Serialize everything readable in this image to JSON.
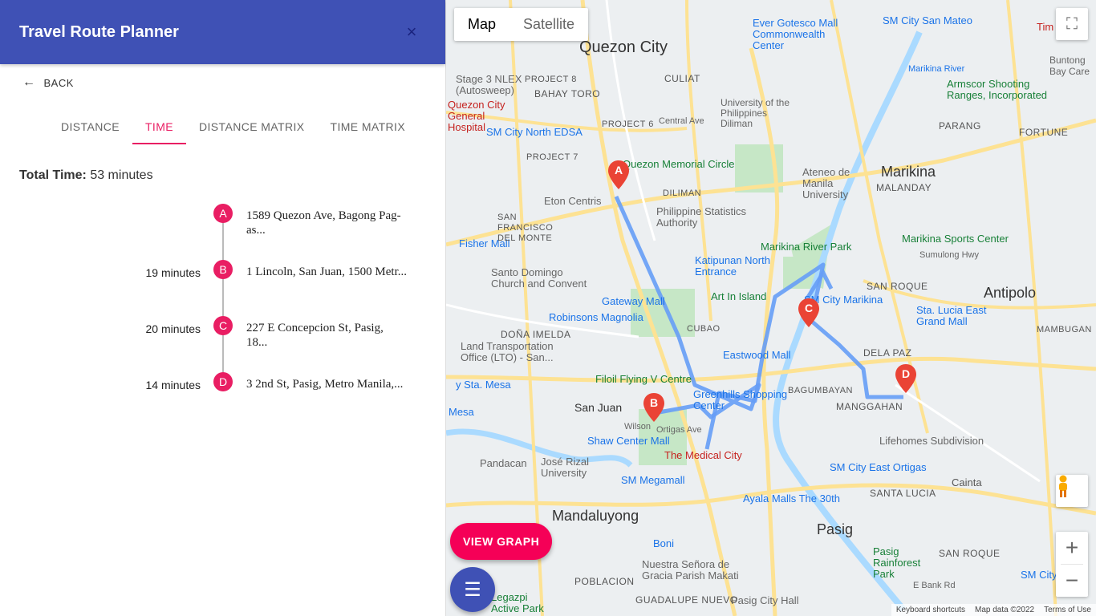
{
  "app": {
    "title": "Travel Route Planner",
    "close_icon": "×"
  },
  "back": {
    "label": "BACK"
  },
  "tabs": [
    {
      "label": "DISTANCE",
      "active": false
    },
    {
      "label": "TIME",
      "active": true
    },
    {
      "label": "DISTANCE MATRIX",
      "active": false
    },
    {
      "label": "TIME MATRIX",
      "active": false
    }
  ],
  "summary": {
    "label": "Total Time:",
    "value": "53 minutes"
  },
  "stops": [
    {
      "letter": "A",
      "duration": "",
      "address": "1589 Quezon Ave, Bagong Pag-as..."
    },
    {
      "letter": "B",
      "duration": "19 minutes",
      "address": "1 Lincoln, San Juan, 1500 Metr..."
    },
    {
      "letter": "C",
      "duration": "20 minutes",
      "address": "227 E Concepcion St, Pasig, 18..."
    },
    {
      "letter": "D",
      "duration": "14 minutes",
      "address": "3 2nd St, Pasig, Metro Manila,..."
    }
  ],
  "map": {
    "type_controls": {
      "map": "Map",
      "satellite": "Satellite"
    },
    "labels": {
      "quezon_city": "Quezon City",
      "marikina": "Marikina",
      "antipolo": "Antipolo",
      "mandaluyong": "Mandaluyong",
      "pasig": "Pasig",
      "san_juan": "San Juan",
      "cainta": "Cainta",
      "ever_gotesco": "Ever Gotesco Mall",
      "commonwealth": "Commonwealth Center",
      "sm_san_mateo": "SM City San Mateo",
      "quezon_memorial": "Quezon Memorial Circle",
      "eton": "Eton Centris",
      "psa": "Philippine Statistics Authority",
      "fisher": "Fisher Mall",
      "santo_domingo": "Santo Domingo Church and Convent",
      "gateway": "Gateway Mall",
      "art_in_island": "Art In Island",
      "robinsons_magnolia": "Robinsons Magnolia",
      "katipunan_north": "Katipunan North Entrance",
      "marikina_river_park": "Marikina River Park",
      "marikina_sports": "Marikina Sports Center",
      "sm_marikina": "SM City Marikina",
      "sta_lucia": "Sta. Lucia East Grand Mall",
      "eastwood": "Eastwood Mall",
      "filoil": "Filoil Flying V Centre",
      "greenhills": "Greenhills Shopping Center",
      "shaw": "Shaw Center Mall",
      "medical_city": "The Medical City",
      "sm_megamall": "SM Megamall",
      "ayala_30th": "Ayala Malls The 30th",
      "sm_east_ortigas": "SM City East Ortigas",
      "lifehomes": "Lifehomes Subdivision",
      "pasig_rainforest": "Pasig Rainforest Park",
      "sm_taytay": "SM City Ta",
      "pasig_city_hall": "Pasig City Hall",
      "nuestra": "Nuestra Señora de Gracia Parish Makati",
      "jose_rizal": "José Rizal University",
      "legazpi": "Legazpi Active Park",
      "sm_north": "SM City North EDSA",
      "ateneo": "Ateneo de Manila University",
      "up": "University of the Philippines Diliman",
      "armscor": "Armscor Shooting Ranges, Incorporated",
      "qc_hospital": "Quezon City General Hospital",
      "lto": "Land Transportation Office (LTO) - San...",
      "dela_paz": "DELA PAZ",
      "manggahan": "MANGGAHAN",
      "bagumbayan": "BAGUMBAYAN",
      "san_roque": "SAN ROQUE",
      "santa_lucia": "SANTA LUCIA",
      "malanday": "MALANDAY",
      "parang": "PARANG",
      "fortune": "FORTUNE",
      "culiat": "CULIAT",
      "bahay_toro": "BAHAY TORO",
      "diliman": "DILIMAN",
      "cubao": "CUBAO",
      "dona_imelda": "DOÑA IMELDA",
      "poblacion": "POBLACION",
      "guadalupe": "GUADALUPE NUEVO",
      "mambugan": "MAMBUGAN",
      "san_francisco": "SAN FRANCISCO DEL MONTE",
      "project6": "PROJECT 6",
      "project7": "PROJECT 7",
      "project8": "PROJECT 8",
      "central_ave": "Central Ave",
      "pandacan": "Pandacan",
      "boni": "Boni",
      "timog": "Tim",
      "buntong": "Buntong Bay Care",
      "stage3": "Stage 3 NLEX (Autosweep)",
      "sta_mesa": "y Sta. Mesa",
      "mesa": "Mesa",
      "marikina_river": "Marikina River",
      "ortigas_ave": "Ortigas Ave",
      "wilson": "Wilson",
      "sumulong": "Sumulong Hwy",
      "e_bank": "E Bank Rd"
    },
    "pins": [
      "A",
      "B",
      "C",
      "D"
    ],
    "view_graph": "VIEW GRAPH",
    "attribution": {
      "shortcuts": "Keyboard shortcuts",
      "data": "Map data ©2022",
      "terms": "Terms of Use"
    },
    "colors": {
      "route": "#669df6",
      "pin": "#ea4335",
      "road": "#fde293",
      "park": "#c6e7c6",
      "water": "#aadaff"
    }
  }
}
